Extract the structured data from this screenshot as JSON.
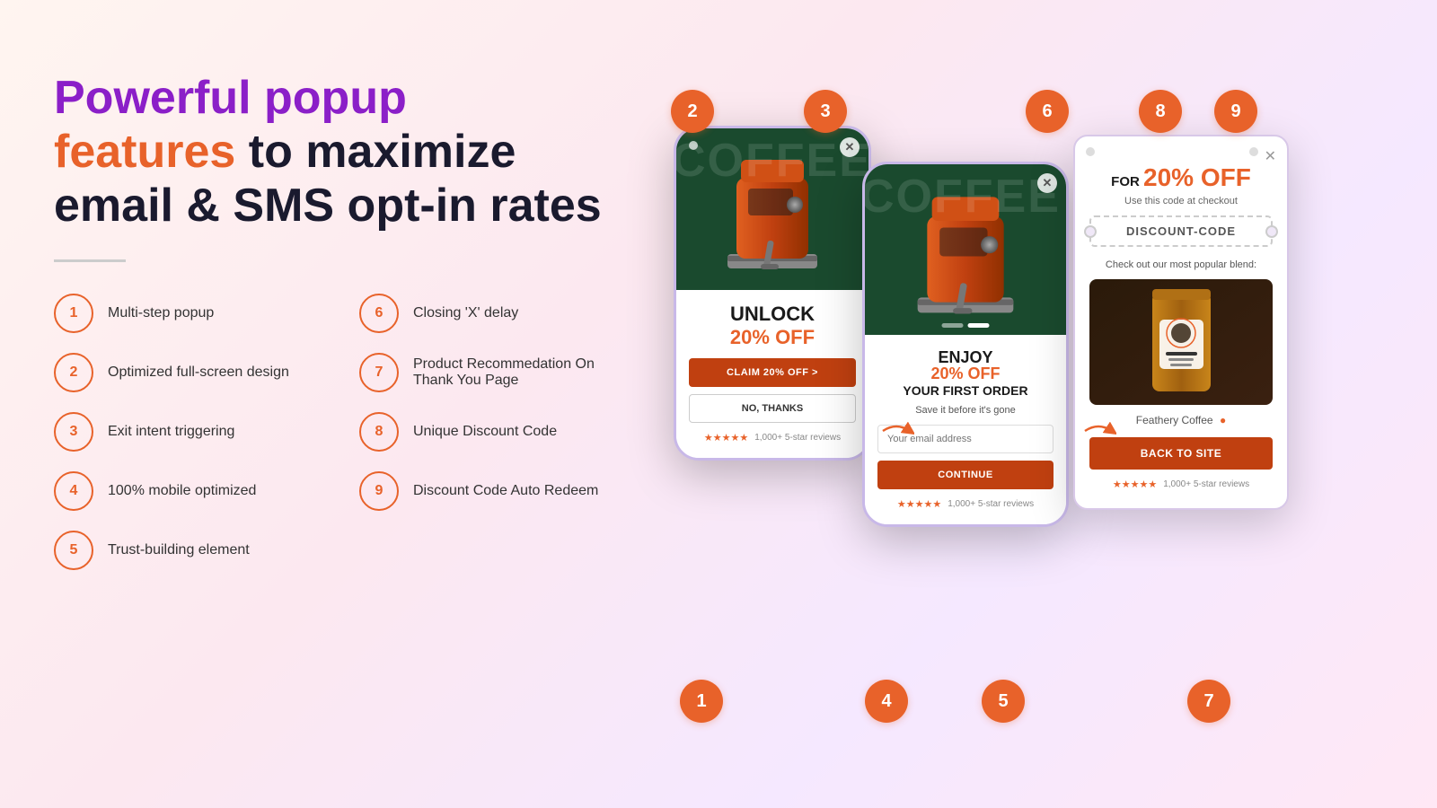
{
  "headline": {
    "part1": "Powerful popup",
    "part2": "features",
    "part3": " to maximize",
    "part4": "email & SMS opt-in rates"
  },
  "features": [
    {
      "num": "1",
      "text": "Multi-step popup"
    },
    {
      "num": "2",
      "text": "Optimized full-screen design"
    },
    {
      "num": "3",
      "text": "Exit intent triggering"
    },
    {
      "num": "4",
      "text": "100% mobile optimized"
    },
    {
      "num": "5",
      "text": "Trust-building element"
    },
    {
      "num": "6",
      "text": "Closing 'X' delay"
    },
    {
      "num": "7",
      "text": "Product Recommedation On Thank You Page"
    },
    {
      "num": "8",
      "text": "Unique Discount Code"
    },
    {
      "num": "9",
      "text": "Discount Code Auto Redeem"
    }
  ],
  "popup1": {
    "unlock": "UNLOCK",
    "discount": "20% OFF",
    "cta_btn": "CLAIM 20% OFF  >",
    "no_thanks": "NO, THANKS",
    "reviews": "1,000+ 5-star reviews"
  },
  "popup2": {
    "enjoy": "ENJOY",
    "discount": "20% OFF",
    "subtitle": "YOUR FIRST ORDER",
    "save_text": "Save it before it's gone",
    "email_placeholder": "Your email address",
    "continue_btn": "CONTINUE",
    "reviews": "1,000+ 5-star reviews"
  },
  "popup3": {
    "for_text": "FOR",
    "discount": "20% OFF",
    "use_text": "Use this code at checkout",
    "discount_code": "DISCOUNT-CODE",
    "popular_text": "Check out our most popular blend:",
    "product_name": "Feathery Coffee",
    "back_btn": "BACK TO SITE",
    "reviews": "1,000+ 5-star reviews"
  },
  "badges": [
    "1",
    "2",
    "3",
    "4",
    "5",
    "6",
    "7",
    "8",
    "9"
  ],
  "colors": {
    "orange": "#E8622A",
    "dark_orange": "#c04010",
    "purple": "#8B1FC8",
    "dark_green": "#1a4a2e"
  }
}
